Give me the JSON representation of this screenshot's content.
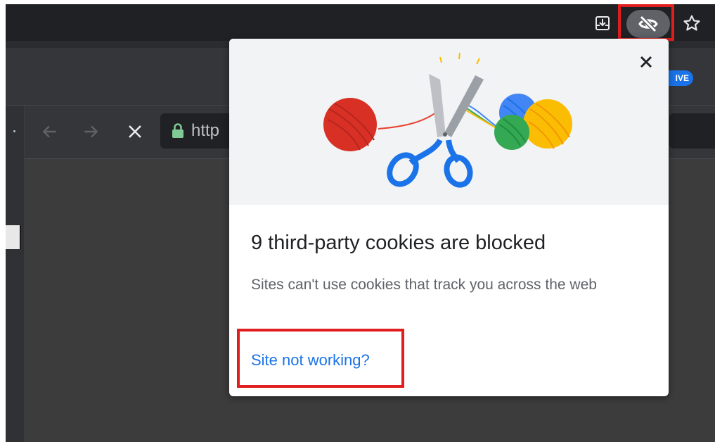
{
  "browser": {
    "omnibox_url": "http",
    "badge_text": "IVE",
    "icons": {
      "download": "download-icon",
      "tracking": "eye-off-icon",
      "bookmark": "star-icon",
      "back": "back-arrow-icon",
      "forward": "forward-arrow-icon",
      "stop": "stop-icon",
      "lock": "lock-icon"
    }
  },
  "popup": {
    "title": "9 third-party cookies are blocked",
    "description": "Sites can't use cookies that track you across the web",
    "link_label": "Site not working?",
    "close_icon": "close-icon"
  },
  "colors": {
    "accent": "#1a73e8",
    "highlight": "#e01e1e",
    "chrome_dark": "#202124"
  }
}
